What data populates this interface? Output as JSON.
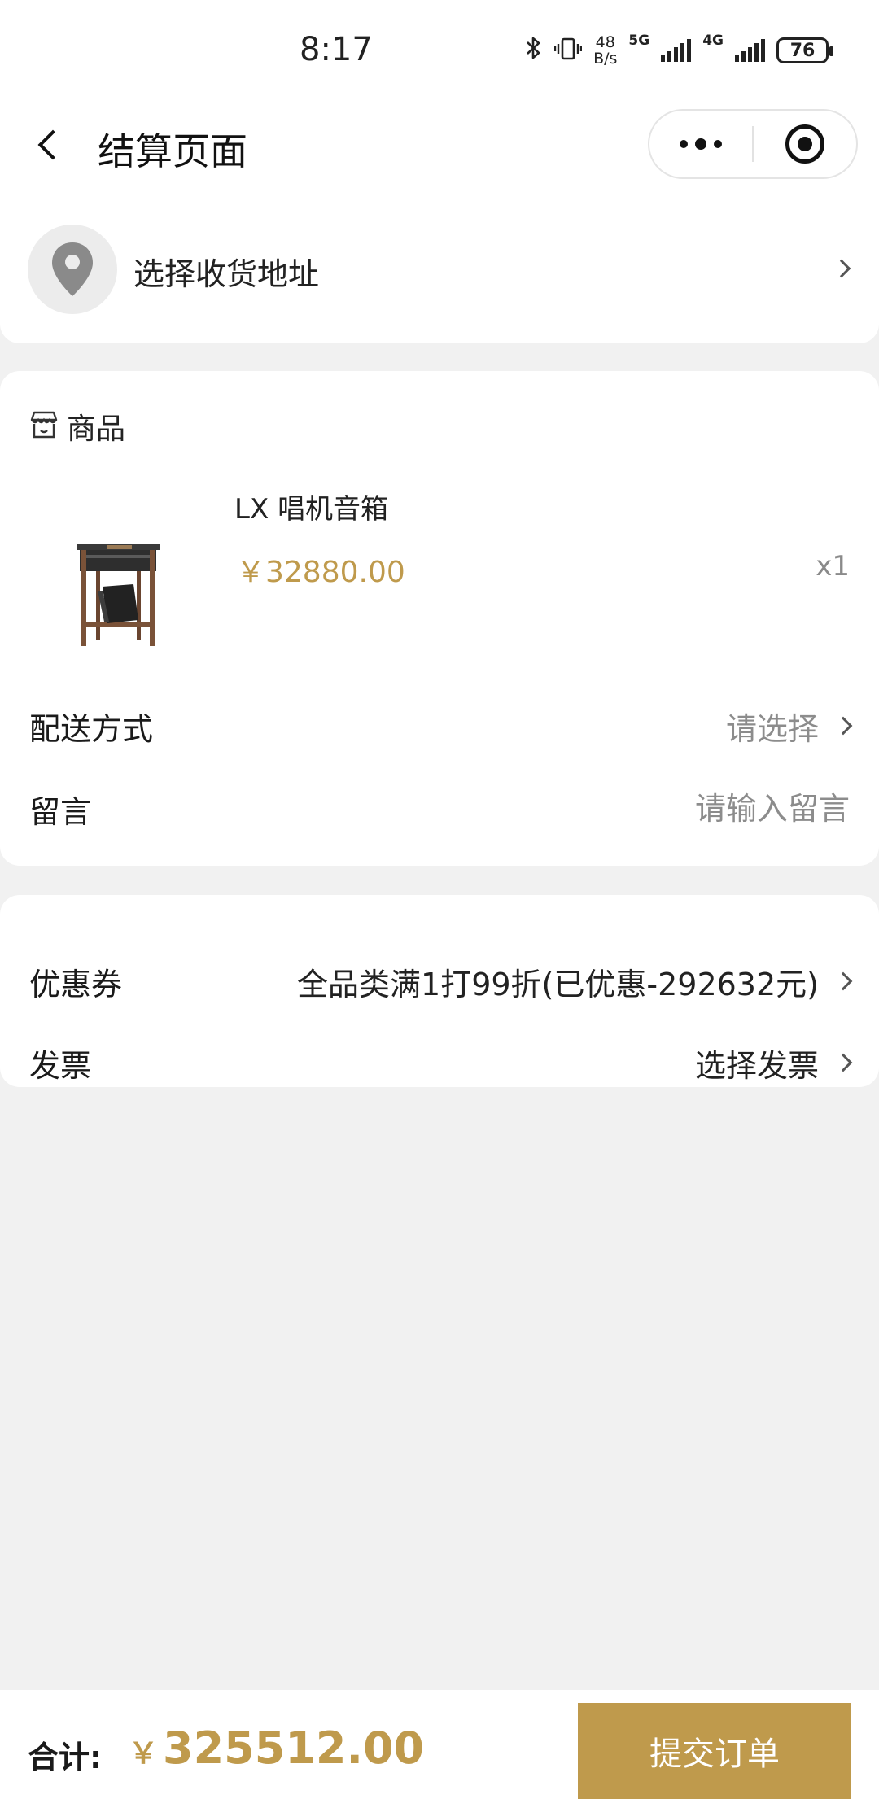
{
  "status_bar": {
    "time": "8:17",
    "bluetooth_icon": "bluetooth-icon",
    "vibrate_icon": "vibrate-icon",
    "net_speed_value": "48",
    "net_speed_unit": "B/s",
    "network_1": "5G",
    "network_2": "4G",
    "battery": "76"
  },
  "nav": {
    "title": "结算页面"
  },
  "address": {
    "label": "选择收货地址"
  },
  "goods": {
    "section_label": "商品",
    "product_name": "LX 唱机音箱",
    "product_price": "￥32880.00",
    "quantity": "x1",
    "delivery_label": "配送方式",
    "delivery_value": "请选择",
    "message_label": "留言",
    "message_placeholder": "请输入留言"
  },
  "promo": {
    "coupon_label": "优惠券",
    "coupon_value": "全品类满1打99折(已优惠-292632元)",
    "invoice_label": "发票",
    "invoice_value": "选择发票"
  },
  "footer": {
    "total_label": "合计:",
    "currency": "￥",
    "total_amount": "325512.00",
    "submit_label": "提交订单"
  },
  "colors": {
    "accent": "#bf9a4c",
    "background": "#f1f1f1",
    "placeholder": "#8c8c8c"
  }
}
